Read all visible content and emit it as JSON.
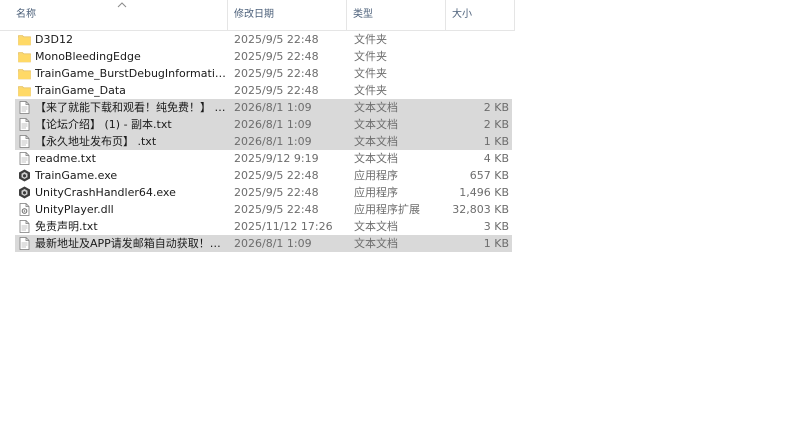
{
  "columns": {
    "name": "名称",
    "date": "修改日期",
    "type": "类型",
    "size": "大小"
  },
  "files": [
    {
      "name": "D3D12",
      "date": "2025/9/5 22:48",
      "type": "文件夹",
      "size": "",
      "icon": "folder-icon",
      "selected": false
    },
    {
      "name": "MonoBleedingEdge",
      "date": "2025/9/5 22:48",
      "type": "文件夹",
      "size": "",
      "icon": "folder-icon",
      "selected": false
    },
    {
      "name": "TrainGame_BurstDebugInformation_DoNotShip",
      "date": "2025/9/5 22:48",
      "type": "文件夹",
      "size": "",
      "icon": "folder-icon",
      "selected": false
    },
    {
      "name": "TrainGame_Data",
      "date": "2025/9/5 22:48",
      "type": "文件夹",
      "size": "",
      "icon": "folder-icon",
      "selected": false
    },
    {
      "name": "【来了就能下载和观看！纯免费！】 - 副本.txt",
      "date": "2026/8/1 1:09",
      "type": "文本文档",
      "size": "2 KB",
      "icon": "text-file-icon",
      "selected": true
    },
    {
      "name": "【论坛介绍】 (1) - 副本.txt",
      "date": "2026/8/1 1:09",
      "type": "文本文档",
      "size": "2 KB",
      "icon": "text-file-icon",
      "selected": true
    },
    {
      "name": "【永久地址发布页】 .txt",
      "date": "2026/8/1 1:09",
      "type": "文本文档",
      "size": "1 KB",
      "icon": "text-file-icon",
      "selected": true
    },
    {
      "name": "readme.txt",
      "date": "2025/9/12 9:19",
      "type": "文本文档",
      "size": "4 KB",
      "icon": "text-file-icon",
      "selected": false
    },
    {
      "name": "TrainGame.exe",
      "date": "2025/9/5 22:48",
      "type": "应用程序",
      "size": "657 KB",
      "icon": "unity-app-icon",
      "selected": false
    },
    {
      "name": "UnityCrashHandler64.exe",
      "date": "2025/9/5 22:48",
      "type": "应用程序",
      "size": "1,496 KB",
      "icon": "unity-app-icon",
      "selected": false
    },
    {
      "name": "UnityPlayer.dll",
      "date": "2025/9/5 22:48",
      "type": "应用程序扩展",
      "size": "32,803 KB",
      "icon": "dll-file-icon",
      "selected": false
    },
    {
      "name": "免责声明.txt",
      "date": "2025/11/12 17:26",
      "type": "文本文档",
      "size": "3 KB",
      "icon": "text-file-icon",
      "selected": false
    },
    {
      "name": "最新地址及APP请发邮箱自动获取！！！.txt",
      "date": "2026/8/1 1:09",
      "type": "文本文档",
      "size": "1 KB",
      "icon": "text-file-icon",
      "selected": true
    }
  ]
}
